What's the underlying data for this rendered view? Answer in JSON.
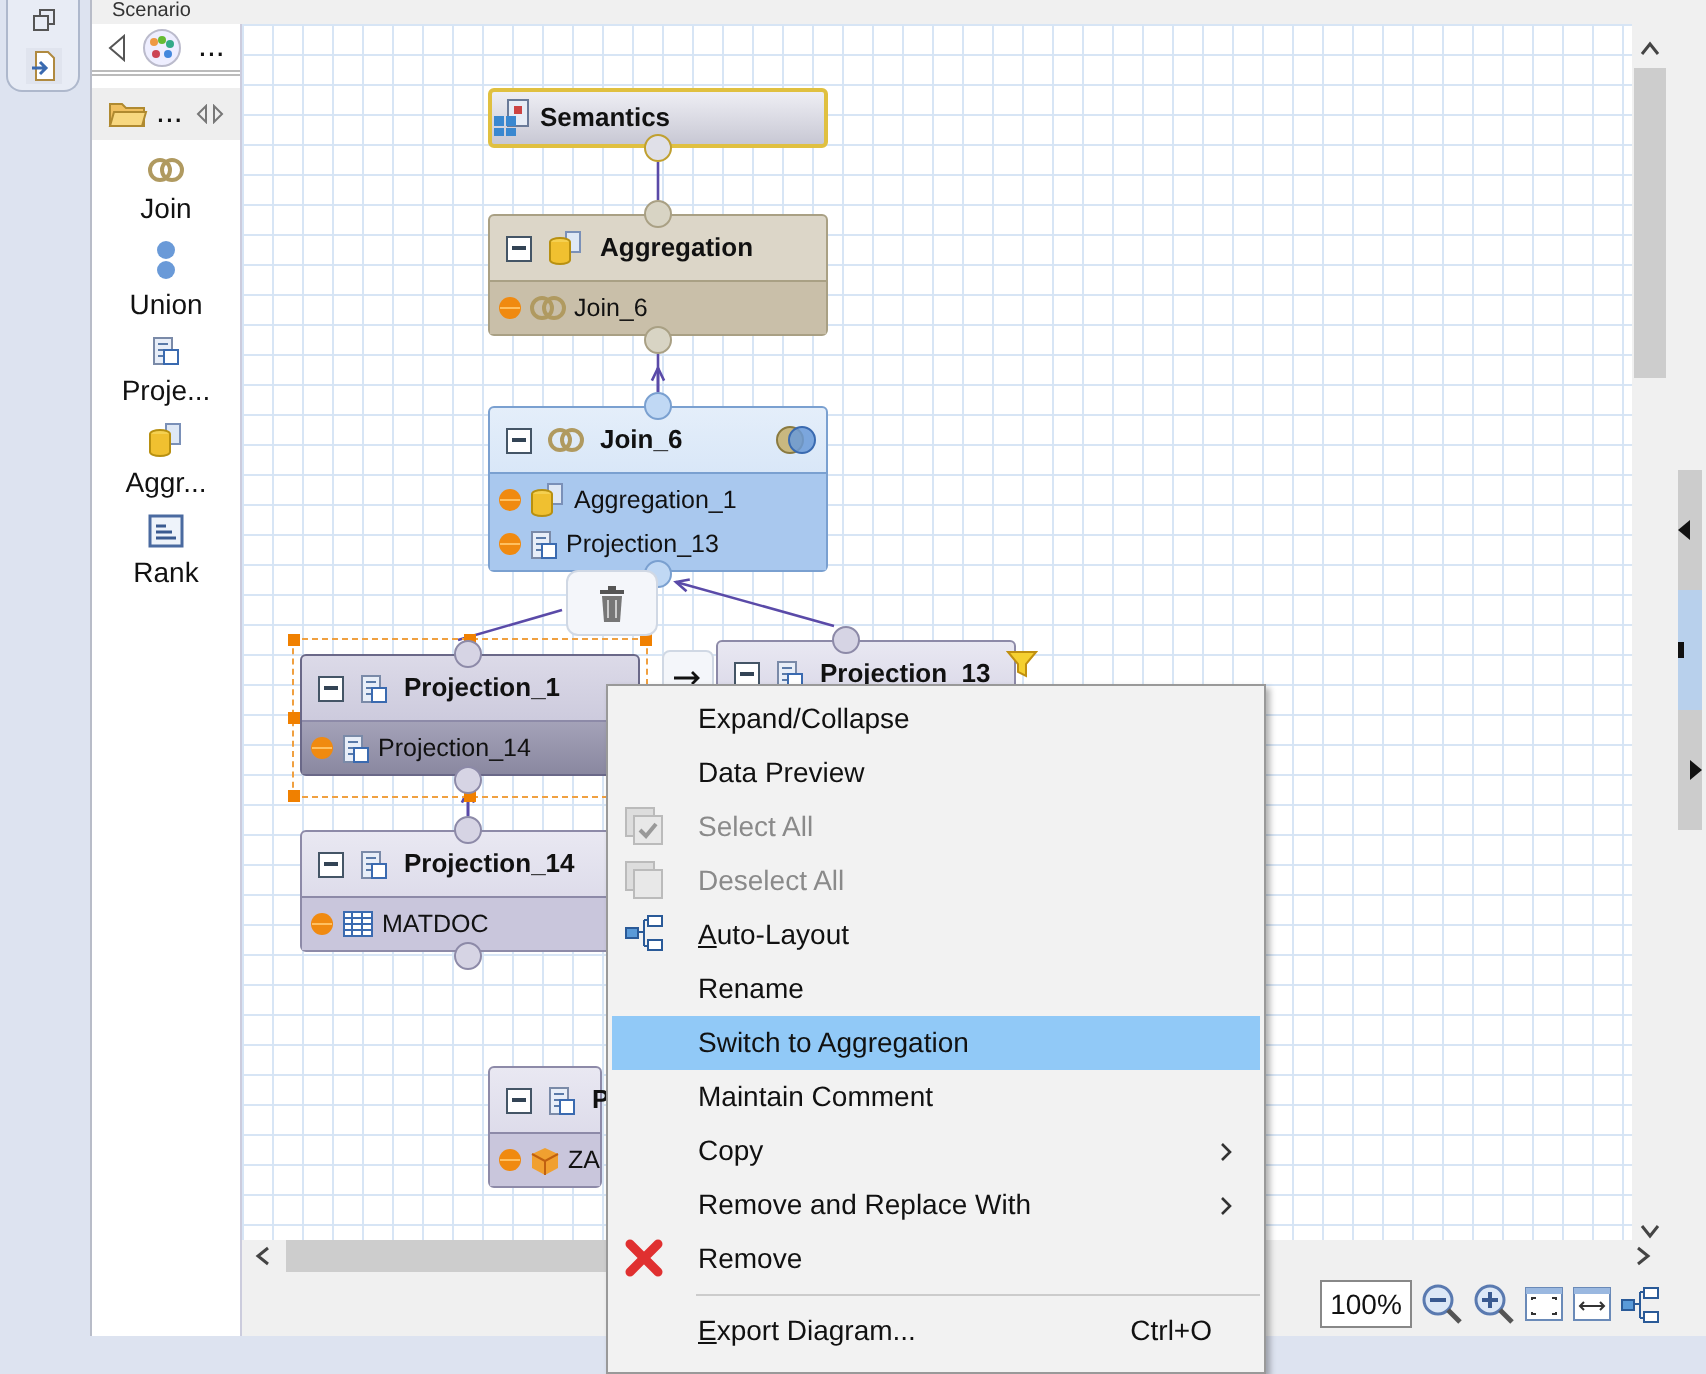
{
  "title": "Scenario",
  "palette": {
    "toolbar_more": "...",
    "folder_label": "...",
    "items": [
      {
        "label": "Join",
        "kind": "join"
      },
      {
        "label": "Union",
        "kind": "union"
      },
      {
        "label": "Proje...",
        "kind": "projection"
      },
      {
        "label": "Aggr...",
        "kind": "aggregation"
      },
      {
        "label": "Rank",
        "kind": "rank"
      }
    ]
  },
  "nodes": [
    {
      "kind": "semantics",
      "title": "Semantics",
      "selected": false
    },
    {
      "kind": "aggregation",
      "title": "Aggregation",
      "selected": false,
      "inputs": [
        {
          "label": "Join_6",
          "kind": "join"
        }
      ]
    },
    {
      "kind": "join",
      "title": "Join_6",
      "selected": false,
      "inputs": [
        {
          "label": "Aggregation_1",
          "kind": "aggregation"
        },
        {
          "label": "Projection_13",
          "kind": "projection"
        }
      ]
    },
    {
      "kind": "projection",
      "title": "Projection_1",
      "selected": true,
      "inputs": [
        {
          "label": "Projection_14",
          "kind": "projection"
        }
      ]
    },
    {
      "kind": "projection",
      "title": "Projection_13",
      "selected": false
    },
    {
      "kind": "projection",
      "title": "Projection_14",
      "selected": false,
      "inputs": [
        {
          "label": "MATDOC",
          "kind": "table"
        }
      ]
    },
    {
      "kind": "projection",
      "title": "P",
      "selected": false,
      "inputs": [
        {
          "label": "ZA",
          "kind": "cube"
        }
      ]
    }
  ],
  "context_menu": {
    "items": [
      {
        "kind": "command",
        "label": "Expand/Collapse",
        "disabled": false,
        "selected": false
      },
      {
        "kind": "command",
        "label": "Data Preview",
        "disabled": false,
        "selected": false
      },
      {
        "kind": "command",
        "label": "Select All",
        "disabled": true,
        "selected": false
      },
      {
        "kind": "command",
        "label": "Deselect All",
        "disabled": true,
        "selected": false
      },
      {
        "kind": "command",
        "label": "Auto-Layout",
        "disabled": false,
        "selected": false,
        "underline_first": true
      },
      {
        "kind": "command",
        "label": "Rename",
        "disabled": false,
        "selected": false
      },
      {
        "kind": "command",
        "label": "Switch to Aggregation",
        "disabled": false,
        "selected": true
      },
      {
        "kind": "command",
        "label": "Maintain Comment",
        "disabled": false,
        "selected": false
      },
      {
        "kind": "submenu",
        "label": "Copy",
        "disabled": false,
        "selected": false
      },
      {
        "kind": "submenu",
        "label": "Remove and Replace With",
        "disabled": false,
        "selected": false
      },
      {
        "kind": "command",
        "label": "Remove",
        "disabled": false,
        "selected": false
      },
      {
        "kind": "separator"
      },
      {
        "kind": "command",
        "label": "Export Diagram...",
        "disabled": false,
        "selected": false,
        "underline_first": true,
        "shortcut": "Ctrl+O"
      }
    ]
  },
  "zoom": {
    "value": "100%"
  }
}
